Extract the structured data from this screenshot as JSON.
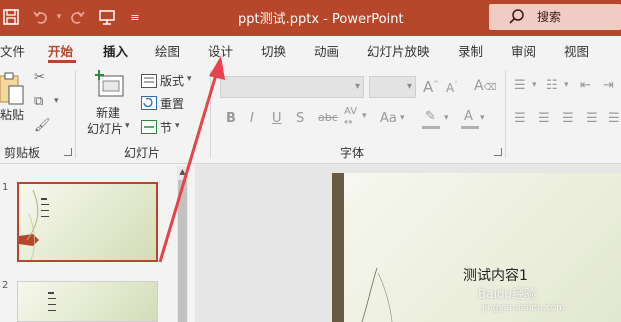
{
  "titlebar": {
    "title": "ppt测试.pptx  -  PowerPoint",
    "search_label": "搜索",
    "accent": "#b7472a"
  },
  "tabs": [
    {
      "label": "文件"
    },
    {
      "label": "开始"
    },
    {
      "label": "插入"
    },
    {
      "label": "绘图"
    },
    {
      "label": "设计"
    },
    {
      "label": "切换"
    },
    {
      "label": "动画"
    },
    {
      "label": "幻灯片放映"
    },
    {
      "label": "录制"
    },
    {
      "label": "审阅"
    },
    {
      "label": "视图"
    }
  ],
  "ribbon": {
    "clipboard": {
      "paste_label": "粘贴",
      "group_label": "剪贴板"
    },
    "slides": {
      "new_slide_line1": "新建",
      "new_slide_line2": "幻灯片",
      "layout_label": "版式",
      "reset_label": "重置",
      "section_label": "节",
      "group_label": "幻灯片"
    },
    "font": {
      "group_label": "字体"
    }
  },
  "slide": {
    "content_text": "测试内容1"
  },
  "thumbnails": [
    {
      "number": "1"
    },
    {
      "number": "2"
    }
  ],
  "watermark": {
    "text": "Baidu经验",
    "url": "jingyan.baidu.com"
  }
}
